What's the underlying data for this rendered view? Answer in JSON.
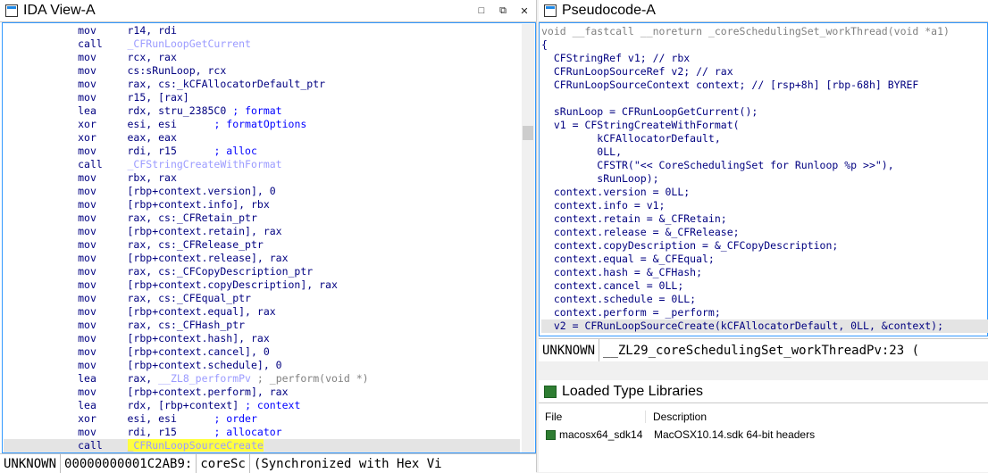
{
  "ida_view": {
    "title": "IDA View-A",
    "btn_restore": "□",
    "btn_float": "⧉",
    "btn_close": "✕",
    "lines": [
      {
        "mn": "mov",
        "ops": "r14, rdi"
      },
      {
        "mn": "call",
        "ops": "_CFRunLoopGetCurrent",
        "fn": true
      },
      {
        "mn": "mov",
        "ops": "rcx, rax"
      },
      {
        "mn": "mov",
        "ops": "cs:sRunLoop, rcx"
      },
      {
        "mn": "mov",
        "ops": "rax, cs:_kCFAllocatorDefault_ptr"
      },
      {
        "mn": "mov",
        "ops": "r15, [rax]"
      },
      {
        "mn": "lea",
        "ops": "rdx, stru_2385C0",
        "cm": "; format"
      },
      {
        "mn": "xor",
        "ops": "esi, esi",
        "cm": "; formatOptions"
      },
      {
        "mn": "xor",
        "ops": "eax, eax"
      },
      {
        "mn": "mov",
        "ops": "rdi, r15",
        "cm": "; alloc"
      },
      {
        "mn": "call",
        "ops": "_CFStringCreateWithFormat",
        "fn": true
      },
      {
        "mn": "mov",
        "ops": "rbx, rax"
      },
      {
        "mn": "mov",
        "ops": "[rbp+context.version], 0"
      },
      {
        "mn": "mov",
        "ops": "[rbp+context.info], rbx"
      },
      {
        "mn": "mov",
        "ops": "rax, cs:_CFRetain_ptr"
      },
      {
        "mn": "mov",
        "ops": "[rbp+context.retain], rax"
      },
      {
        "mn": "mov",
        "ops": "rax, cs:_CFRelease_ptr"
      },
      {
        "mn": "mov",
        "ops": "[rbp+context.release], rax"
      },
      {
        "mn": "mov",
        "ops": "rax, cs:_CFCopyDescription_ptr"
      },
      {
        "mn": "mov",
        "ops": "[rbp+context.copyDescription], rax"
      },
      {
        "mn": "mov",
        "ops": "rax, cs:_CFEqual_ptr"
      },
      {
        "mn": "mov",
        "ops": "[rbp+context.equal], rax"
      },
      {
        "mn": "mov",
        "ops": "rax, cs:_CFHash_ptr"
      },
      {
        "mn": "mov",
        "ops": "[rbp+context.hash], rax"
      },
      {
        "mn": "mov",
        "ops": "[rbp+context.cancel], 0"
      },
      {
        "mn": "mov",
        "ops": "[rbp+context.schedule], 0"
      },
      {
        "mn": "lea",
        "ops": "rax, __ZL8_performPv",
        "cm": "; _perform(void *)",
        "fnop": true
      },
      {
        "mn": "mov",
        "ops": "[rbp+context.perform], rax"
      },
      {
        "mn": "lea",
        "ops": "rdx, [rbp+context]",
        "cm": "; context"
      },
      {
        "mn": "xor",
        "ops": "esi, esi",
        "cm": "; order"
      },
      {
        "mn": "mov",
        "ops": "rdi, r15",
        "cm": "; allocator"
      },
      {
        "mn": "call",
        "ops": "_CFRunLoopSourceCreate",
        "fn": true,
        "hl": true,
        "cur": true
      }
    ],
    "status": {
      "mode": "UNKNOWN",
      "address": "00000000001C2AB9:",
      "func": "coreSc",
      "sync": "(Synchronized with Hex Vi"
    }
  },
  "pseudocode": {
    "title": "Pseudocode-A",
    "header": "void __fastcall __noreturn _coreSchedulingSet_workThread(void *a1)",
    "lines": [
      "{",
      "  CFStringRef v1; // rbx",
      "  CFRunLoopSourceRef v2; // rax",
      "  CFRunLoopSourceContext context; // [rsp+8h] [rbp-68h] BYREF",
      "",
      "  sRunLoop = CFRunLoopGetCurrent();",
      "  v1 = CFStringCreateWithFormat(",
      "         kCFAllocatorDefault,",
      "         0LL,",
      "         CFSTR(\"<< CoreSchedulingSet for Runloop %p >>\"),",
      "         sRunLoop);",
      "  context.version = 0LL;",
      "  context.info = v1;",
      "  context.retain = &_CFRetain;",
      "  context.release = &_CFRelease;",
      "  context.copyDescription = &_CFCopyDescription;",
      "  context.equal = &_CFEqual;",
      "  context.hash = &_CFHash;",
      "  context.cancel = 0LL;",
      "  context.schedule = 0LL;",
      "  context.perform = _perform;",
      "  v2 = CFRunLoopSourceCreate(kCFAllocatorDefault, 0LL, &context);"
    ],
    "status": {
      "mode": "UNKNOWN",
      "location": "__ZL29_coreSchedulingSet_workThreadPv:23 ("
    }
  },
  "type_libs": {
    "title": "Loaded Type Libraries",
    "col_file": "File",
    "col_desc": "Description",
    "rows": [
      {
        "file": "macosx64_sdk14",
        "desc": "MacOSX10.14.sdk 64-bit headers"
      }
    ]
  }
}
